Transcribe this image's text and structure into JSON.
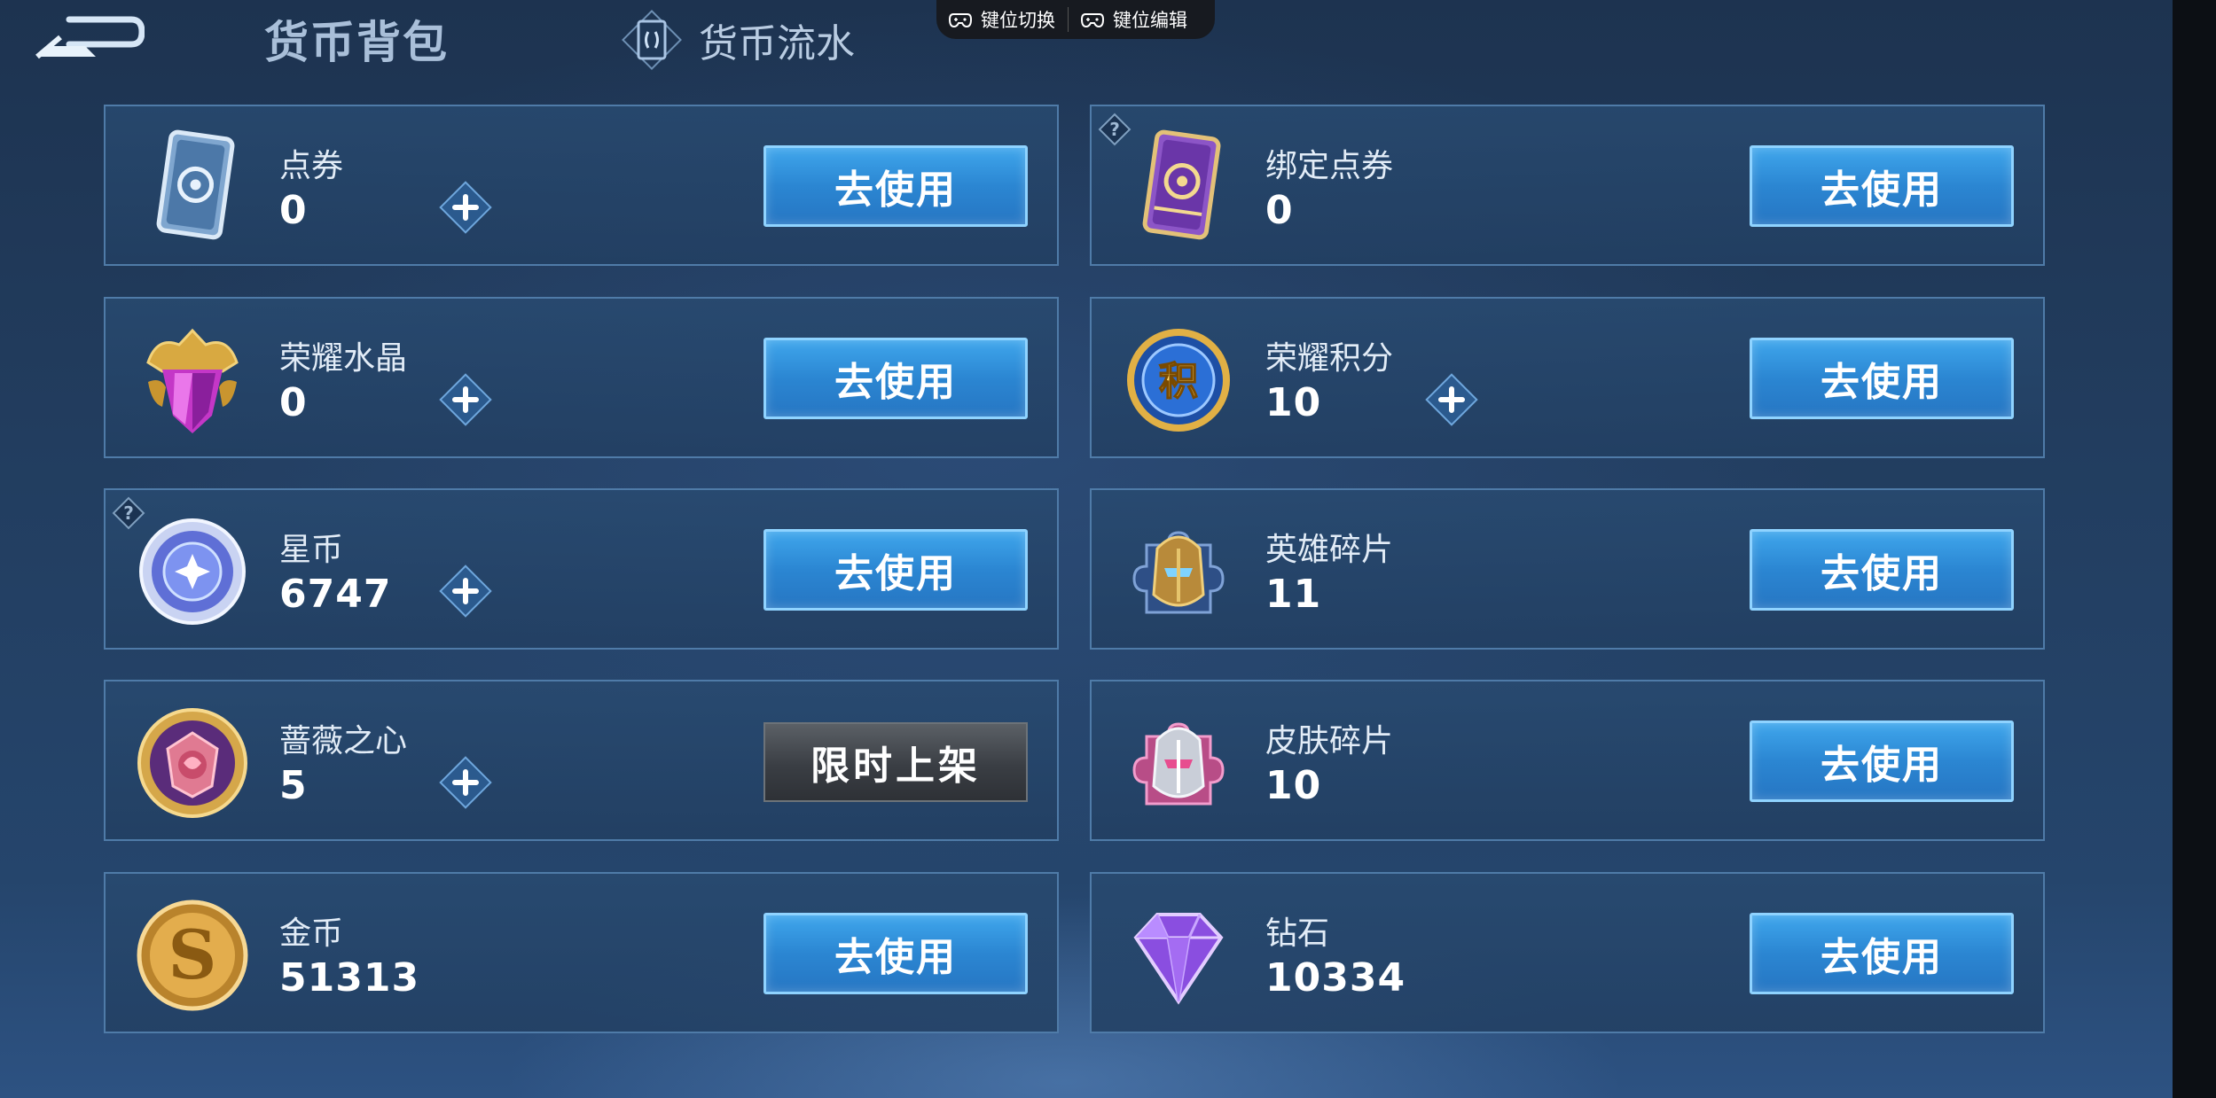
{
  "header": {
    "title": "货币背包",
    "flow_tab": "货币流水"
  },
  "overlay": {
    "key_switch": "键位切换",
    "key_edit": "键位编辑"
  },
  "cards": [
    {
      "name": "点券",
      "amount": "0",
      "icon": "coupon-icon",
      "has_plus": true,
      "has_help": false,
      "button": "去使用",
      "button_type": "use"
    },
    {
      "name": "绑定点券",
      "amount": "0",
      "icon": "bound-coupon-icon",
      "has_plus": false,
      "has_help": true,
      "button": "去使用",
      "button_type": "use"
    },
    {
      "name": "荣耀水晶",
      "amount": "0",
      "icon": "glory-crystal-icon",
      "has_plus": true,
      "has_help": false,
      "button": "去使用",
      "button_type": "use"
    },
    {
      "name": "荣耀积分",
      "amount": "10",
      "icon": "glory-points-icon",
      "has_plus": true,
      "has_help": false,
      "button": "去使用",
      "button_type": "use"
    },
    {
      "name": "星币",
      "amount": "6747",
      "icon": "star-coin-icon",
      "has_plus": true,
      "has_help": true,
      "button": "去使用",
      "button_type": "use"
    },
    {
      "name": "英雄碎片",
      "amount": "11",
      "icon": "hero-fragment-icon",
      "has_plus": false,
      "has_help": false,
      "button": "去使用",
      "button_type": "use"
    },
    {
      "name": "蔷薇之心",
      "amount": "5",
      "icon": "rose-heart-icon",
      "has_plus": true,
      "has_help": false,
      "button": "限时上架",
      "button_type": "limited"
    },
    {
      "name": "皮肤碎片",
      "amount": "10",
      "icon": "skin-fragment-icon",
      "has_plus": false,
      "has_help": false,
      "button": "去使用",
      "button_type": "use"
    },
    {
      "name": "金币",
      "amount": "51313",
      "icon": "gold-coin-icon",
      "has_plus": false,
      "has_help": false,
      "button": "去使用",
      "button_type": "use"
    },
    {
      "name": "钻石",
      "amount": "10334",
      "icon": "diamond-icon",
      "has_plus": false,
      "has_help": false,
      "button": "去使用",
      "button_type": "use"
    }
  ],
  "icons": {
    "glory_points_glyph": "积",
    "gold_coin_glyph": "S"
  },
  "colors": {
    "accent_blue": "#2b86d2",
    "button_border": "#8fd3ff",
    "card_border": "#4f7ba8"
  }
}
